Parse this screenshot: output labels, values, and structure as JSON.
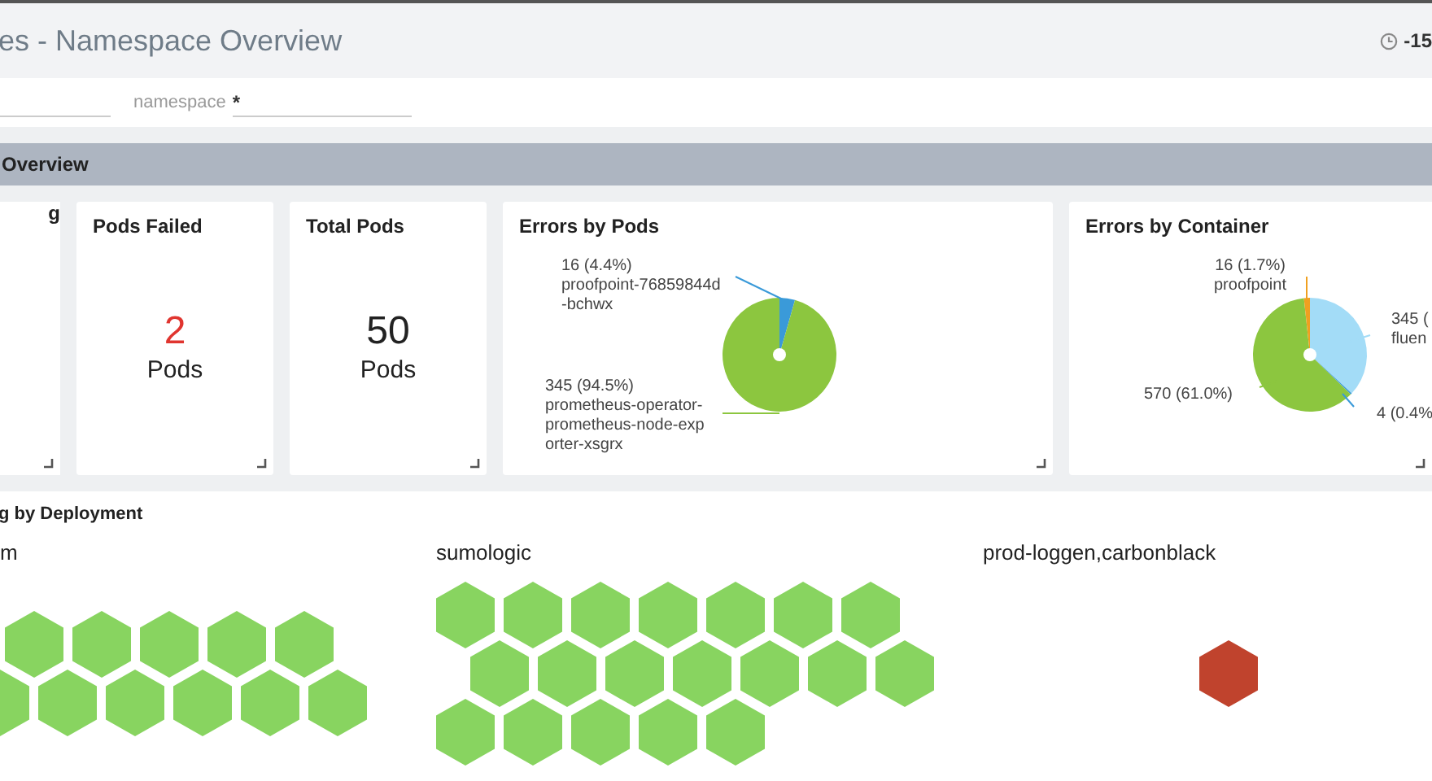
{
  "header": {
    "title": "es - Namespace Overview",
    "time_range": "-15"
  },
  "filters": [
    {
      "kind": "bare"
    },
    {
      "kind": "labeled",
      "label": "namespace",
      "value": "*"
    }
  ],
  "section": {
    "title": "Overview"
  },
  "cards": [
    {
      "kind": "stat",
      "title": "g"
    },
    {
      "kind": "stat",
      "title": "Pods Failed",
      "value": "2",
      "unit": "Pods",
      "alert": true
    },
    {
      "kind": "stat",
      "title": "Total Pods",
      "value": "50",
      "unit": "Pods",
      "alert": false
    },
    {
      "kind": "pie",
      "title": "Errors by Pods",
      "chart_data": {
        "type": "pie",
        "values": [
          4.4,
          95.6
        ],
        "colors": [
          "#3a9ad9",
          "#8cc63f"
        ]
      },
      "labels": [
        {
          "value": "16 (4.4%)",
          "name": "proofpoint-76859844d-bchwx"
        },
        {
          "value": "345 (94.5%)",
          "name": "prometheus-operator-prometheus-node-exporter-xsgrx"
        }
      ]
    },
    {
      "kind": "pie",
      "title": "Errors by Container",
      "chart_data": {
        "type": "pie",
        "values": [
          1.7,
          36.9,
          0.4,
          61.0
        ],
        "colors": [
          "#f0a020",
          "#a3dcf7",
          "#3a9ad9",
          "#8cc63f"
        ]
      },
      "labels": [
        {
          "value": "16 (1.7%)",
          "name": "proofpoint"
        },
        {
          "value": "345 (",
          "name": "fluen"
        },
        {
          "value": "4 (0.4%"
        },
        {
          "value": "570 (61.0%)"
        }
      ]
    }
  ],
  "deployments": {
    "title": "g by Deployment",
    "groups": [
      {
        "name": "m",
        "rows": [
          {
            "pods": [
              {
                "color": "#88d460"
              },
              {
                "color": "#88d460"
              },
              {
                "color": "#88d460"
              },
              {
                "color": "#88d460"
              },
              {
                "color": "#88d460"
              }
            ]
          },
          {
            "pods": [
              {
                "color": "#88d460"
              },
              {
                "color": "#88d460"
              },
              {
                "color": "#88d460"
              },
              {
                "color": "#88d460"
              },
              {
                "color": "#88d460"
              },
              {
                "color": "#88d460"
              }
            ]
          }
        ]
      },
      {
        "name": "sumologic",
        "rows": [
          {
            "pods": [
              {
                "color": "#88d460"
              },
              {
                "color": "#88d460"
              },
              {
                "color": "#88d460"
              },
              {
                "color": "#88d460"
              },
              {
                "color": "#88d460"
              },
              {
                "color": "#88d460"
              },
              {
                "color": "#88d460"
              }
            ]
          },
          {
            "pods": [
              {
                "color": "#88d460"
              },
              {
                "color": "#88d460"
              },
              {
                "color": "#88d460"
              },
              {
                "color": "#88d460"
              },
              {
                "color": "#88d460"
              },
              {
                "color": "#88d460"
              },
              {
                "color": "#88d460"
              }
            ]
          },
          {
            "pods": [
              {
                "color": "#88d460"
              },
              {
                "color": "#88d460"
              },
              {
                "color": "#88d460"
              },
              {
                "color": "#88d460"
              },
              {
                "color": "#88d460"
              }
            ]
          }
        ]
      },
      {
        "name": "prod-loggen,carbonblack",
        "rows": [
          {
            "pods": [
              {
                "color": "#c0432d"
              }
            ]
          }
        ]
      }
    ]
  }
}
